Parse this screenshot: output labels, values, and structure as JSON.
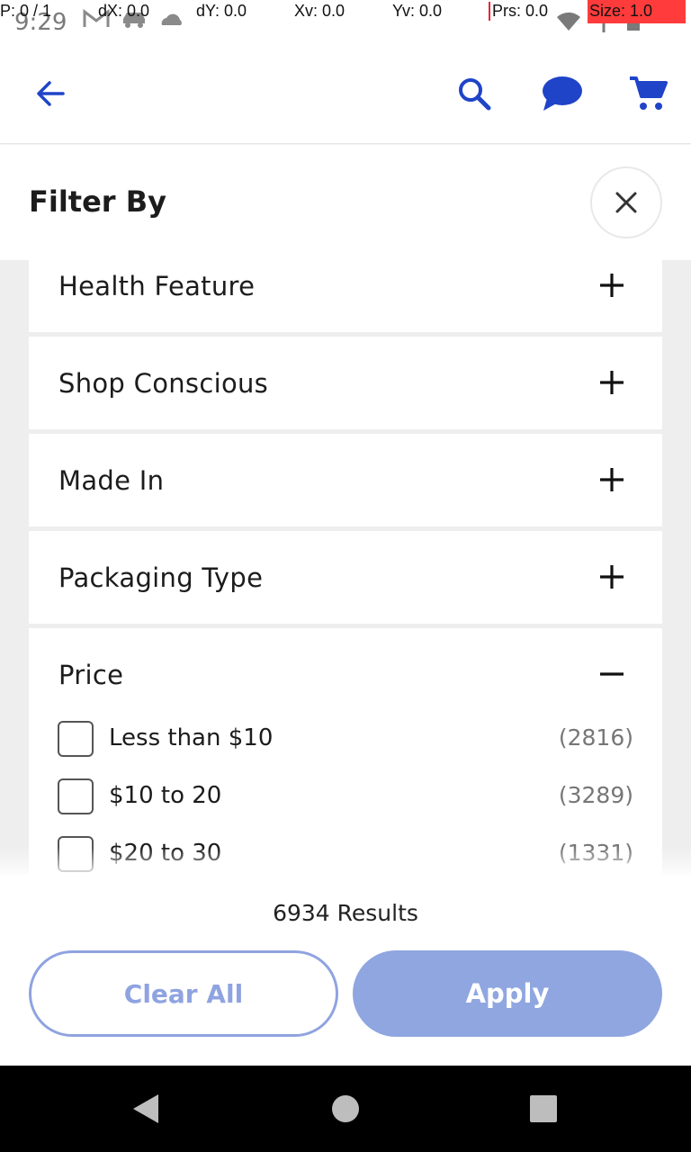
{
  "status_bar": {
    "time": "9:29",
    "debug": {
      "pointer": "P: 0 / 1",
      "dx": "dX: 0.0",
      "dy": "dY: 0.0",
      "xv": "Xv: 0.0",
      "yv": "Yv: 0.0",
      "prs": "Prs: 0.0",
      "size": "Size: 1.0"
    }
  },
  "app_bar": {
    "icons": [
      "back-arrow-icon",
      "search-icon",
      "chat-icon",
      "cart-icon"
    ],
    "accent": "#1f44c8"
  },
  "filter": {
    "title": "Filter By",
    "sections": [
      {
        "label": "Health Feature",
        "state": "collapsed"
      },
      {
        "label": "Shop Conscious",
        "state": "collapsed"
      },
      {
        "label": "Made In",
        "state": "collapsed"
      },
      {
        "label": "Packaging Type",
        "state": "collapsed"
      },
      {
        "label": "Price",
        "state": "expanded"
      }
    ],
    "price_options": [
      {
        "label": "Less than $10",
        "count": "(2816)",
        "checked": false
      },
      {
        "label": "$10 to 20",
        "count": "(3289)",
        "checked": false
      },
      {
        "label": "$20 to 30",
        "count": "(1331)",
        "checked": false
      }
    ]
  },
  "footer": {
    "results": "6934 Results",
    "clear_label": "Clear All",
    "apply_label": "Apply",
    "button_color": "#8fa6e0"
  }
}
